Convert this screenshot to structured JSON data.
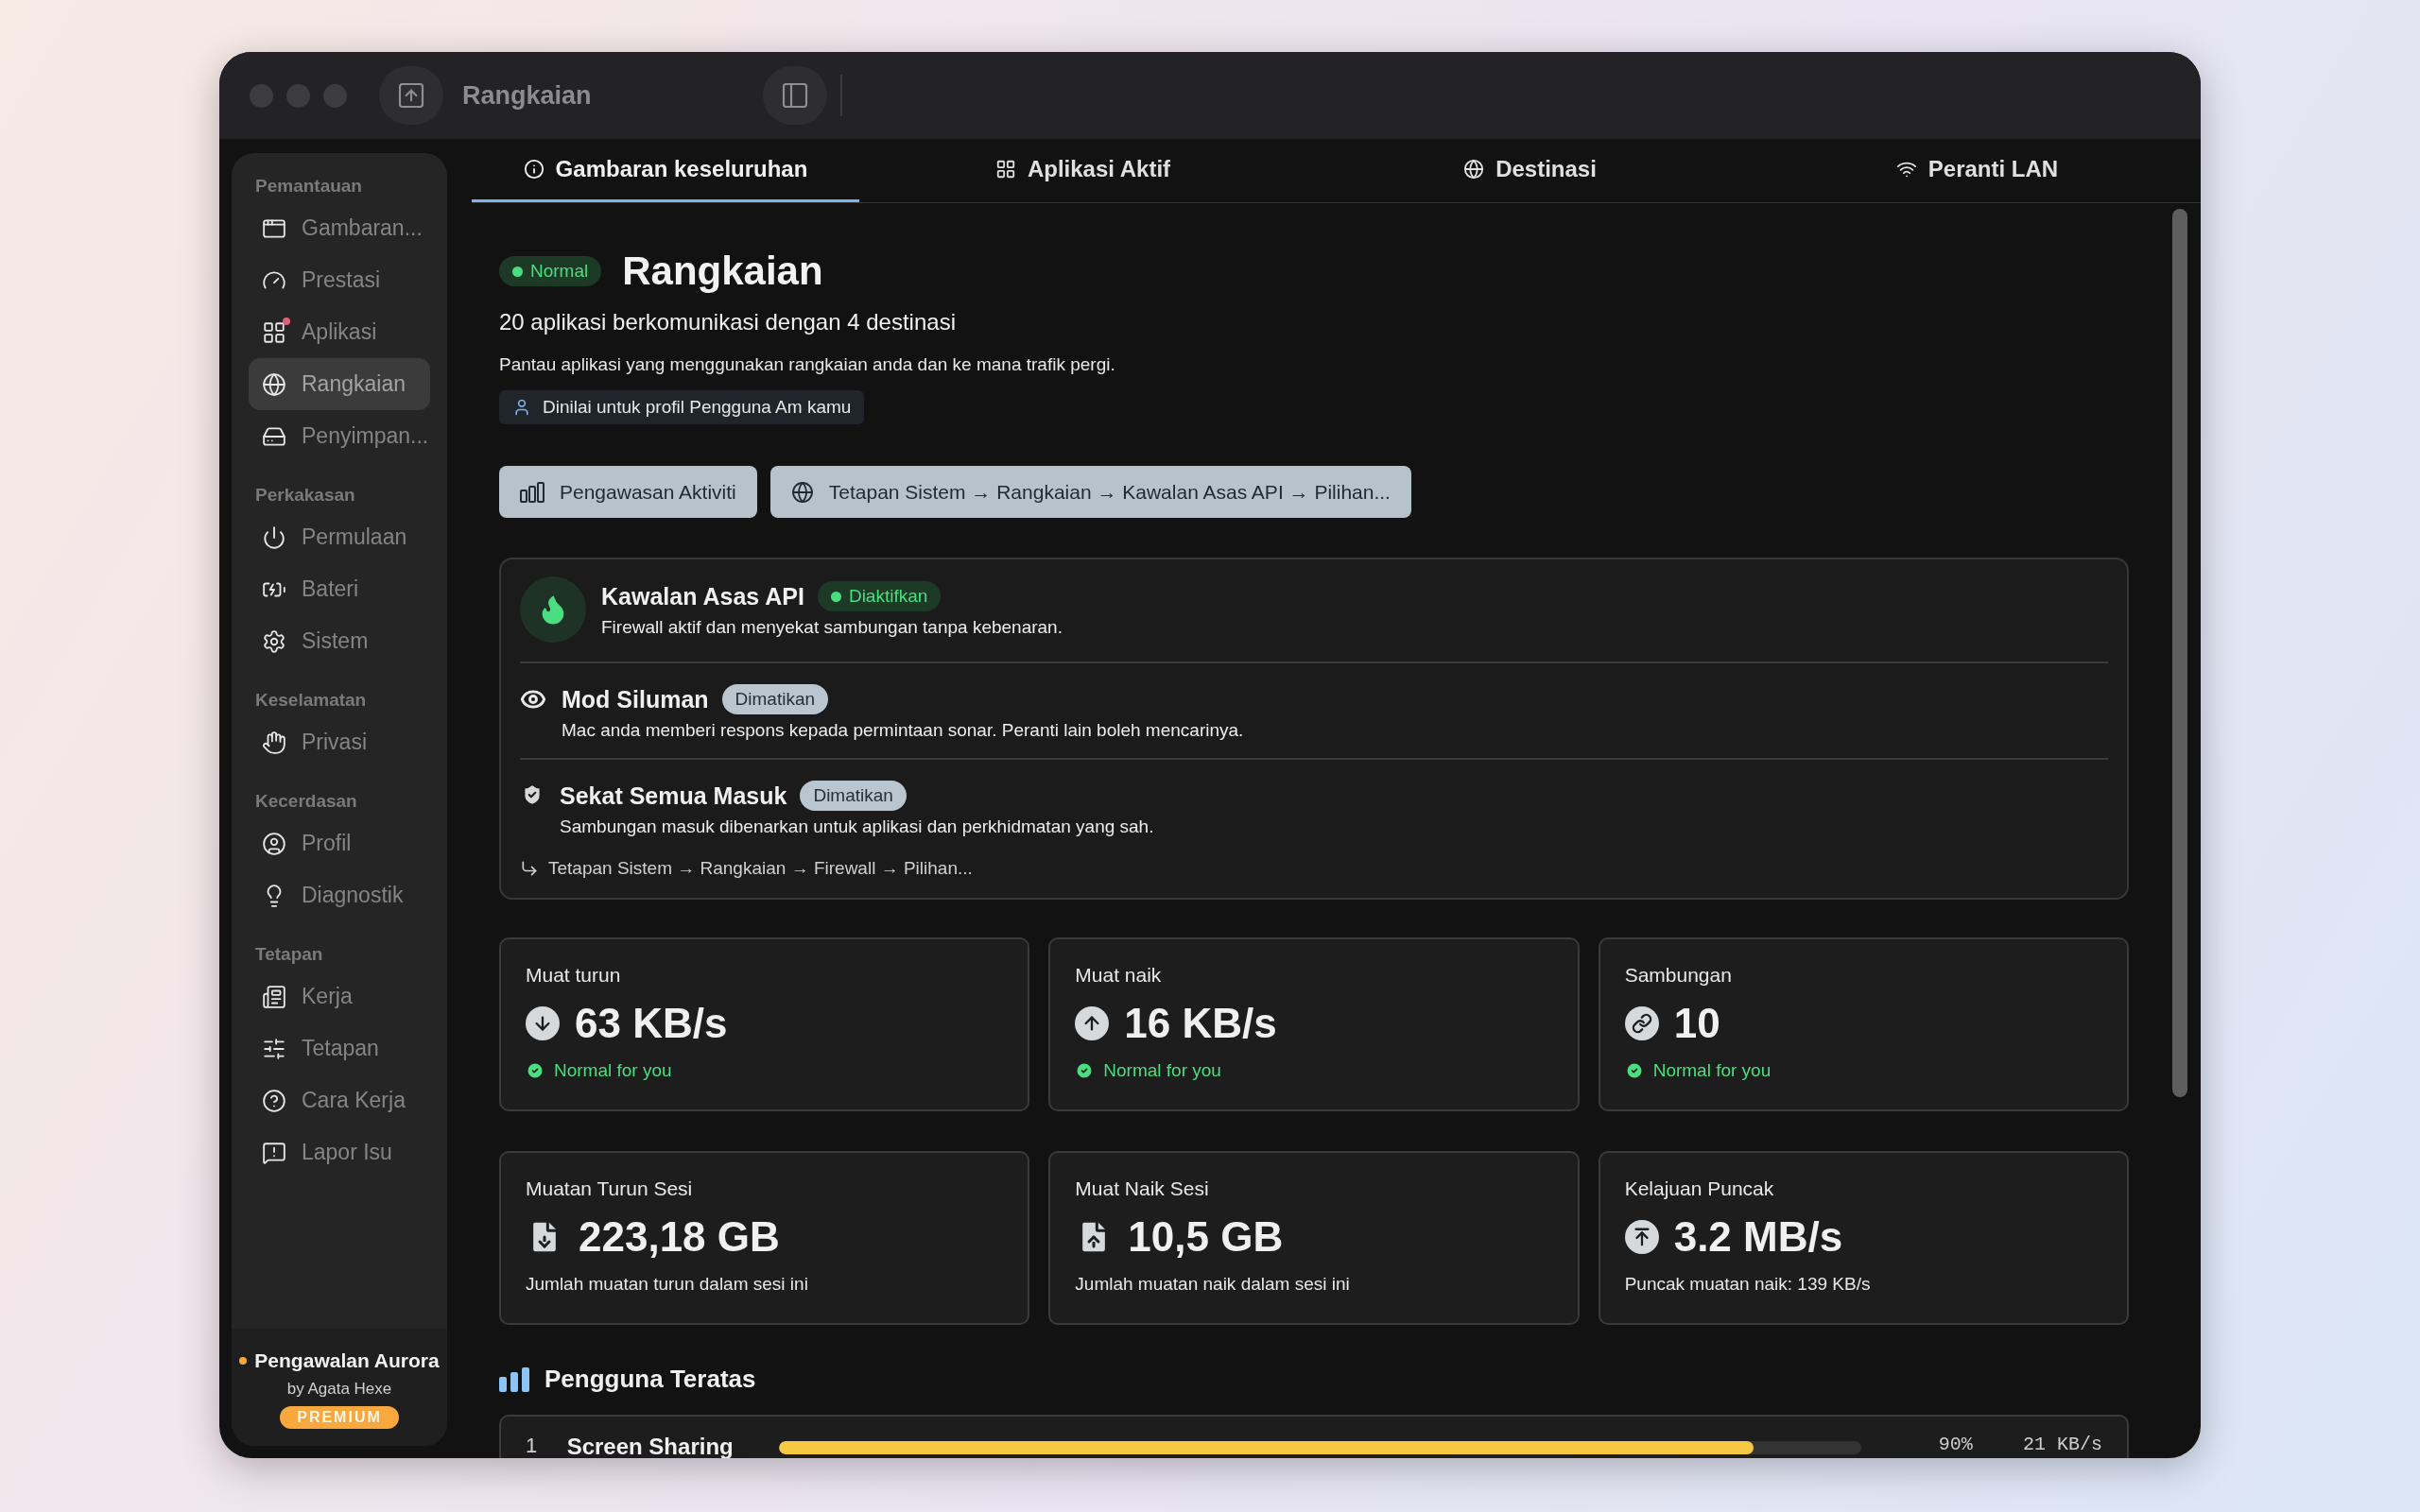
{
  "window": {
    "title": "Rangkaian"
  },
  "sidebar": {
    "sections": [
      {
        "title": "Pemantauan",
        "items": [
          {
            "label": "Gambaran...",
            "selected": false,
            "notification": false
          },
          {
            "label": "Prestasi",
            "selected": false,
            "notification": false
          },
          {
            "label": "Aplikasi",
            "selected": false,
            "notification": true
          },
          {
            "label": "Rangkaian",
            "selected": true,
            "notification": false
          },
          {
            "label": "Penyimpan...",
            "selected": false,
            "notification": false
          }
        ]
      },
      {
        "title": "Perkakasan",
        "items": [
          {
            "label": "Permulaan",
            "selected": false,
            "notification": false
          },
          {
            "label": "Bateri",
            "selected": false,
            "notification": false
          },
          {
            "label": "Sistem",
            "selected": false,
            "notification": false
          }
        ]
      },
      {
        "title": "Keselamatan",
        "items": [
          {
            "label": "Privasi",
            "selected": false,
            "notification": false
          }
        ]
      },
      {
        "title": "Kecerdasan",
        "items": [
          {
            "label": "Profil",
            "selected": false,
            "notification": false
          },
          {
            "label": "Diagnostik",
            "selected": false,
            "notification": false
          }
        ]
      },
      {
        "title": "Tetapan",
        "items": [
          {
            "label": "Kerja",
            "selected": false,
            "notification": false
          },
          {
            "label": "Tetapan",
            "selected": false,
            "notification": false
          },
          {
            "label": "Cara Kerja",
            "selected": false,
            "notification": false
          },
          {
            "label": "Lapor Isu",
            "selected": false,
            "notification": false
          }
        ]
      }
    ],
    "footer": {
      "name": "Pengawalan Aurora",
      "author": "by Agata Hexe",
      "badge": "PREMIUM"
    }
  },
  "tabs": [
    {
      "label": "Gambaran keseluruhan",
      "selected": true
    },
    {
      "label": "Aplikasi Aktif",
      "selected": false
    },
    {
      "label": "Destinasi",
      "selected": false
    },
    {
      "label": "Peranti LAN",
      "selected": false
    }
  ],
  "header": {
    "status": "Normal",
    "title": "Rangkaian",
    "summary": "20 aplikasi berkomunikasi dengan 4 destinasi",
    "description": "Pantau aplikasi yang menggunakan rangkaian anda dan ke mana trafik pergi.",
    "profile": "Dinilai untuk profil Pengguna Am kamu"
  },
  "actions": [
    {
      "label": "Pengawasan Aktiviti"
    },
    {
      "label": "Tetapan Sistem → Rangkaian → Kawalan Asas API → Pilihan..."
    }
  ],
  "firewall": {
    "items": [
      {
        "title": "Kawalan Asas API",
        "status": "Diaktifkan",
        "enabled": true,
        "description": "Firewall aktif dan menyekat sambungan tanpa kebenaran."
      },
      {
        "title": "Mod Siluman",
        "status": "Dimatikan",
        "enabled": false,
        "description": "Mac anda memberi respons kepada permintaan sonar. Peranti lain boleh mencarinya."
      },
      {
        "title": "Sekat Semua Masuk",
        "status": "Dimatikan",
        "enabled": false,
        "description": "Sambungan masuk dibenarkan untuk aplikasi dan perkhidmatan yang sah."
      }
    ],
    "path": "Tetapan Sistem → Rangkaian → Firewall → Pilihan..."
  },
  "stats": [
    {
      "label": "Muat turun",
      "value": "63 KB/s",
      "note": "Normal for you",
      "kind": "status"
    },
    {
      "label": "Muat naik",
      "value": "16 KB/s",
      "note": "Normal for you",
      "kind": "status"
    },
    {
      "label": "Sambungan",
      "value": "10",
      "note": "Normal for you",
      "kind": "status"
    },
    {
      "label": "Muatan Turun Sesi",
      "value": "223,18 GB",
      "note": "Jumlah muatan turun dalam sesi ini",
      "kind": "detail"
    },
    {
      "label": "Muat Naik Sesi",
      "value": "10,5 GB",
      "note": "Jumlah muatan naik dalam sesi ini",
      "kind": "detail"
    },
    {
      "label": "Kelajuan Puncak",
      "value": "3.2 MB/s",
      "note": "Puncak muatan naik: 139 KB/s",
      "kind": "detail"
    }
  ],
  "top_users": {
    "title": "Pengguna Teratas",
    "rows": [
      {
        "rank": "1",
        "name": "Screen Sharing",
        "level": 0.9,
        "percent": "90%",
        "rate": "21 KB/s"
      }
    ]
  }
}
